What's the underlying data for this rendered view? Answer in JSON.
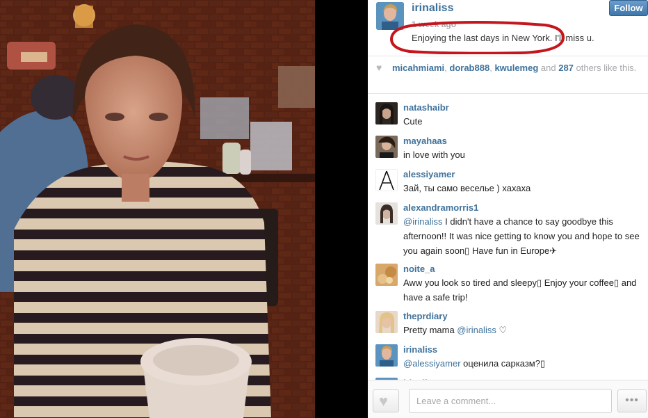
{
  "post": {
    "owner": "irinaliss",
    "timestamp": "1 week ago",
    "caption": "Enjoying the last days in New York. I'll miss u.",
    "follow_label": "Follow"
  },
  "likes": {
    "likers": [
      "micahmiami",
      "dorab888",
      "kwulemeg"
    ],
    "sep1": ", ",
    "sep2": ", ",
    "and": " and ",
    "count": "287",
    "suffix": " others like this."
  },
  "comments": [
    {
      "user": "natashaibr",
      "text": "Cute"
    },
    {
      "user": "mayahaas",
      "text": "in love with you"
    },
    {
      "user": "alessiyamer",
      "text": "Зай, ты само веселье ) хахаха"
    },
    {
      "user": "alexandramorris1",
      "mention": "@irinaliss",
      "text": " I didn't have a chance to say goodbye this afternoon!! It was nice getting to know you and hope to see you again soon▯ Have fun in Europe✈"
    },
    {
      "user": "noite_a",
      "text": "Aww you look so tired and sleepy▯ Enjoy your coffee▯ and have a safe trip!"
    },
    {
      "user": "theprdiary",
      "text_before": "Pretty mama ",
      "mention": "@irinaliss",
      "text_after": " ♡"
    },
    {
      "user": "irinaliss",
      "mention": "@alessiyamer",
      "text": " оценила сарказм?▯"
    },
    {
      "user": "irinaliss"
    }
  ],
  "footer": {
    "comment_placeholder": "Leave a comment...",
    "more_label": "•••"
  },
  "icons": {
    "heart": "heart-icon",
    "more": "ellipsis-icon"
  },
  "colors": {
    "link": "#3f729b",
    "follow": "#3f77ab",
    "annotation": "#c4161c"
  }
}
